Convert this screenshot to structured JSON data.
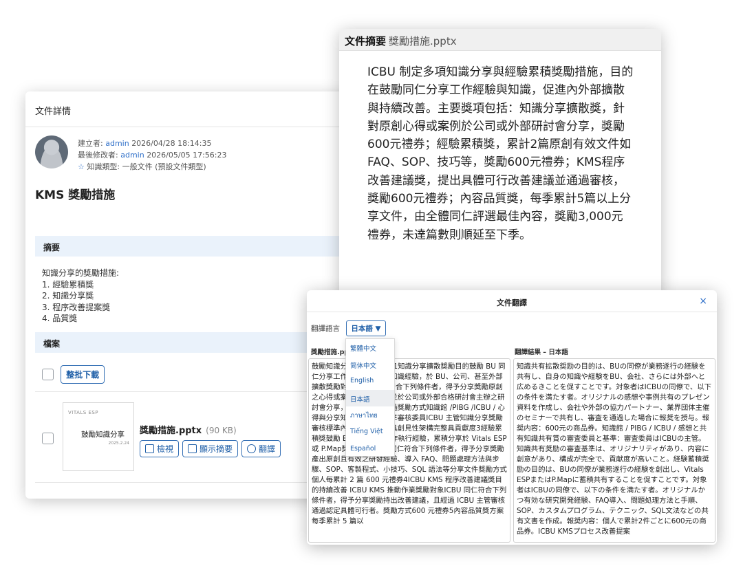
{
  "details": {
    "header_title": "文件詳情",
    "creator_label": "建立者:",
    "creator_name": "admin",
    "created_at": "2026/04/28 18:14:35",
    "modifier_label": "最後修改者:",
    "modifier_name": "admin",
    "modified_at": "2026/05/05 17:56:23",
    "knowledge_type": "知識類型: 一般文件 (預設文件類型)",
    "doc_title": "KMS 獎勵措施",
    "summary_section": "摘要",
    "summary_lines": [
      "知識分享的獎勵措施:",
      "1. 經驗累積獎",
      "2. 知識分享獎",
      "3. 程序改善提案獎",
      "4. 品質獎"
    ],
    "files_section": "檔案",
    "batch_download": "整批下載",
    "file": {
      "name": "獎勵措施.pptx",
      "size": "(90 KB)",
      "thumb_logo": "VITALS ESP",
      "thumb_title": "鼓勵知識分享",
      "thumb_date": "2025.2.24",
      "view": "檢視",
      "show_summary": "顯示摘要",
      "translate": "翻譯"
    }
  },
  "summary_panel": {
    "title": "文件摘要",
    "filename": "獎勵措施.pptx",
    "body": "ICBU 制定多項知識分享與經驗累積獎勵措施，目的在鼓勵同仁分享工作經驗與知識，促進內外部擴散與持續改善。主要獎項包括：知識分享擴散獎，針對原創心得或案例於公司或外部研討會分享，獎勵600元禮券；經驗累積獎，累計2篇原創有效文件如FAQ、SOP、技巧等，獎勵600元禮券；KMS程序改善建議獎，提出具體可行改善建議並通過審核，獎勵600元禮券；內容品質獎，每季累計5篇以上分享文件，由全體同仁評選最佳內容，獎勵3,000元禮券，未達篇數則順延至下季。"
  },
  "translate": {
    "title": "文件翻譯",
    "close": "×",
    "language_label": "翻譯語言",
    "selected_language": "日本語 ▼",
    "source_label": "獎勵措施.pptx",
    "result_label": "翻譯結果 – 日本語",
    "languages": [
      "繁體中文",
      "简体中文",
      "English",
      "日本語",
      "ภาษาไทย",
      "Tiếng Việt",
      "Español"
    ],
    "source_text": "鼓勵知識分享 2025.2.241知識分享擴散獎勵目的鼓勵 BU 同仁分享工作經驗，讓自身知識經驗，於 BU、公司、甚至外部擴散獎勵對象ICBU 同仁符合下列條件者，得予分享獎勵原創之心得或案例分享簡報，並於公司或外部合格研討會主辦之研討會分享，且經過審核通過獎勵方式知識館 /PIBG /ICBU / 心得與分享知識分享獎勵標準審核委員ICBU 主管知識分享獎勵審核標準內容產出內容應具創見性架構完整具貢獻度3經驗累積獎鼓勵 BU 同仁創建工作執行經驗，累積分享於 Vitals ESP 或 P.Map獎勵對象ICBU 同仁符合下列條件者，得予分享獎勵產出原創且有效之研發經驗、導入 FAQ、問題處理方法與步驟、SOP、客製程式、小技巧、SQL 語法等分享文件獎勵方式個人每累計 2 篇 600 元禮券4ICBU KMS 程序改善建議獎目的持續改善 ICBU KMS 推動作業獎勵對象ICBU 同仁符合下列條件者，得予分享獎勵持出改善建議，且經過 ICBU 主管審核通過認定具體可行者。獎勵方式600 元禮券5內容品質獎方案每季累計 5 篇以",
    "result_text": "知識共有拡散奨励の目的は、BUの同僚が業務遂行の経験を共有し、自身の知識や経験をBU、会社、さらには外部へと広めるきことを促すことです。対象者はICBUの同僚で、以下の条件を満たす者。オリジナルの感想や事例共有のプレゼン資料を作成し、会社や外部の協力パートナー、業界団体主催のセミナーで共有し、審査を通過した場合に報奨を授与。報奨内容：600元の商品券。知識館 / PIBG / ICBU / 感想と共有知識共有賞の審査委員と基準：審査委員はICBUの主管。知識共有奨励の審査基準は、オリジナリティがあり、内容に創意があり、構成が完全で、貢献度が高いこと。経験蓄積奨励の目的は、BUの同僚が業務遂行の経験を創出し、Vitals ESPまたはP.Mapに蓄積共有することを促すことです。対象者はICBUの同僚で、以下の条件を満たす者。オリジナルかつ有効な研究開発経験、FAQ導入、問題処理方法と手順、SOP、カスタムプログラム、テクニック、SQL文法などの共有文書を作成。報奨内容：個人で累計2件ごとに600元の商品券。ICBU KMSプロセス改善提案"
  }
}
